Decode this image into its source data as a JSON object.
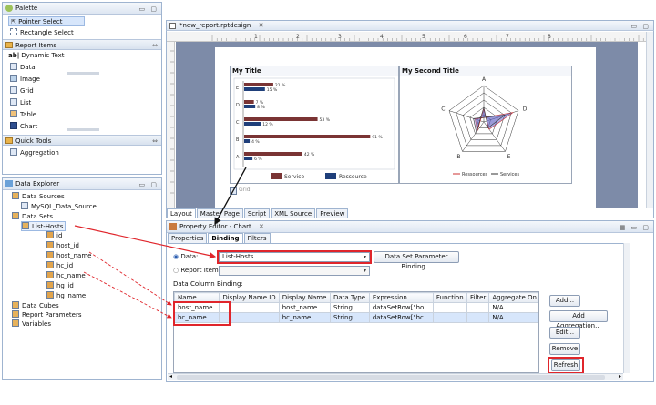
{
  "palette": {
    "title": "Palette",
    "items": [
      "Pointer Select",
      "Rectangle Select"
    ],
    "report_items_section": "Report Items",
    "report_items": [
      "Dynamic Text",
      "Data",
      "Image",
      "Grid",
      "List",
      "Table",
      "Chart"
    ],
    "quick_tools_section": "Quick Tools",
    "quick_tools": [
      "Aggregation"
    ]
  },
  "explorer": {
    "title": "Data Explorer",
    "data_sources": "Data Sources",
    "source_item": "MySQL_Data_Source",
    "data_sets": "Data Sets",
    "dataset_item": "List-Hosts",
    "fields": [
      "id",
      "host_id",
      "host_name",
      "hc_id",
      "hc_name",
      "hg_id",
      "hg_name"
    ],
    "data_cubes": "Data Cubes",
    "report_parameters": "Report Parameters",
    "variables": "Variables"
  },
  "editor": {
    "tab_title": "*new_report.rptdesign",
    "ruler_marks": [
      "1",
      "2",
      "3",
      "4",
      "5",
      "6",
      "7",
      "8"
    ],
    "chart1_title": "My Title",
    "chart2_title": "My Second Title",
    "tabs": [
      "Layout",
      "Master Page",
      "Script",
      "XML Source",
      "Preview"
    ]
  },
  "chart_data": [
    {
      "type": "bar",
      "title": "My Title",
      "categories": [
        "E",
        "D",
        "C",
        "B",
        "A"
      ],
      "series": [
        {
          "name": "Service",
          "values": [
            21,
            7,
            53,
            91,
            42
          ]
        },
        {
          "name": "Ressource",
          "values": [
            15,
            8,
            12,
            4,
            6
          ]
        }
      ],
      "xlim": [
        0,
        100
      ],
      "legend": "bottom",
      "data_label_suffix": "%"
    },
    {
      "type": "radar",
      "title": "My Second Title",
      "axes": [
        "A",
        "B",
        "C",
        "D",
        "E"
      ],
      "series": [
        {
          "name": "Ressources",
          "values": [
            0.35,
            0.3,
            0.25,
            0.85,
            0.25
          ]
        },
        {
          "name": "Services",
          "values": [
            0.4,
            0.35,
            0.3,
            0.6,
            0.2
          ]
        }
      ],
      "legend": "bottom"
    }
  ],
  "prop": {
    "title": "Property Editor - Chart",
    "subtabs": [
      "Properties",
      "Binding",
      "Filters"
    ],
    "data_radio": "Data:",
    "data_value": "List-Hosts",
    "param_button": "Data Set Parameter Binding...",
    "report_item_radio": "Report Item:",
    "binding_label": "Data Column Binding:",
    "columns": [
      "Name",
      "Display Name ID",
      "Display Name",
      "Data Type",
      "Expression",
      "Function",
      "Filter",
      "Aggregate On"
    ],
    "rows": [
      [
        "host_name",
        "",
        "host_name",
        "String",
        "dataSetRow[\"ho...",
        "",
        "",
        "N/A"
      ],
      [
        "hc_name",
        "",
        "hc_name",
        "String",
        "dataSetRow[\"hc...",
        "",
        "",
        "N/A"
      ]
    ],
    "buttons": [
      "Add...",
      "Add Aggregation...",
      "Edit...",
      "Remove",
      "Refresh"
    ]
  },
  "colors": {
    "service": "#7a3434",
    "ressource": "#1f3f7a",
    "accent_red": "#e0252b",
    "selection": "#d7e6fb"
  }
}
